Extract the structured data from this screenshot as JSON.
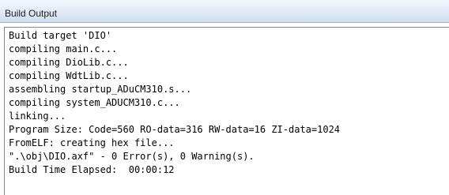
{
  "panel": {
    "title": "Build Output"
  },
  "output": {
    "lines": [
      "Build target 'DIO'",
      "compiling main.c...",
      "compiling DioLib.c...",
      "compiling WdtLib.c...",
      "assembling startup_ADuCM310.s...",
      "compiling system_ADUCM310.c...",
      "linking...",
      "Program Size: Code=560 RO-data=316 RW-data=16 ZI-data=1024",
      "FromELF: creating hex file...",
      "\".\\obj\\DIO.axf\" - 0 Error(s), 0 Warning(s).",
      "Build Time Elapsed:  00:00:12"
    ]
  }
}
